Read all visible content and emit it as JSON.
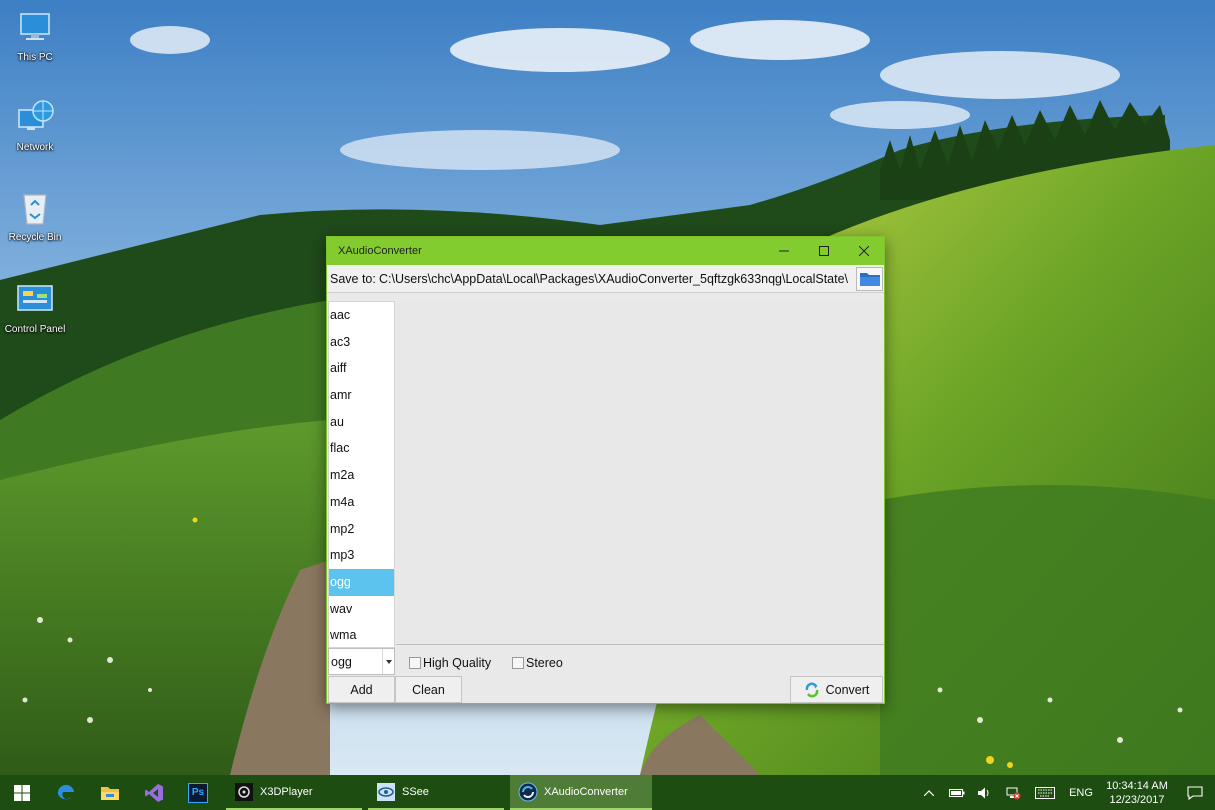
{
  "desktop": {
    "icons": [
      {
        "label": "This PC",
        "icon": "this-pc-icon"
      },
      {
        "label": "Network",
        "icon": "network-icon"
      },
      {
        "label": "Recycle Bin",
        "icon": "recycle-bin-icon"
      },
      {
        "label": "Control Panel",
        "icon": "control-panel-icon"
      }
    ]
  },
  "window": {
    "title": "XAudioConverter",
    "accent_color": "#82cc30",
    "save_label": "Save to:",
    "save_path": "C:\\Users\\chc\\AppData\\Local\\Packages\\XAudioConverter_5qftzgk633nqg\\LocalState\\",
    "formats": [
      "aac",
      "ac3",
      "aiff",
      "amr",
      "au",
      "flac",
      "m2a",
      "m4a",
      "mp2",
      "mp3",
      "ogg",
      "wav",
      "wma"
    ],
    "selected_format": "ogg",
    "format_select_value": "ogg",
    "high_quality_label": "High Quality",
    "high_quality_checked": false,
    "stereo_label": "Stereo",
    "stereo_checked": false,
    "add_label": "Add",
    "clean_label": "Clean",
    "convert_label": "Convert"
  },
  "taskbar": {
    "pinned": [
      "start-icon",
      "edge-icon",
      "file-explorer-icon",
      "visual-studio-icon",
      "photoshop-icon"
    ],
    "photoshop_text": "Ps",
    "apps": [
      {
        "label": "X3DPlayer",
        "active": false
      },
      {
        "label": "SSee",
        "active": false
      },
      {
        "label": "XAudioConverter",
        "active": true
      }
    ],
    "language": "ENG",
    "time": "10:34:14 AM",
    "date": "12/23/2017"
  }
}
